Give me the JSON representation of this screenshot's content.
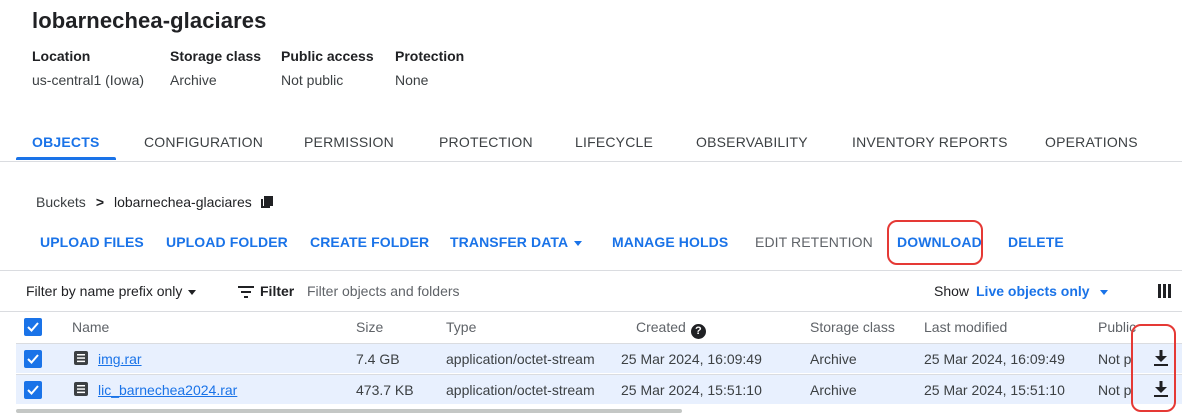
{
  "bucket": {
    "title": "lobarnechea-glaciares"
  },
  "meta": [
    {
      "label": "Location",
      "value": "us-central1 (Iowa)"
    },
    {
      "label": "Storage class",
      "value": "Archive"
    },
    {
      "label": "Public access",
      "value": "Not public"
    },
    {
      "label": "Protection",
      "value": "None"
    }
  ],
  "tabs": [
    "OBJECTS",
    "CONFIGURATION",
    "PERMISSION",
    "PROTECTION",
    "LIFECYCLE",
    "OBSERVABILITY",
    "INVENTORY REPORTS",
    "OPERATIONS"
  ],
  "active_tab": "OBJECTS",
  "breadcrumb": {
    "root": "Buckets",
    "separator": ">",
    "current": "lobarnechea-glaciares"
  },
  "actions": {
    "upload_files": "UPLOAD FILES",
    "upload_folder": "UPLOAD FOLDER",
    "create_folder": "CREATE FOLDER",
    "transfer_data": "TRANSFER DATA",
    "manage_holds": "MANAGE HOLDS",
    "edit_retention": "EDIT RETENTION",
    "download": "DOWNLOAD",
    "delete": "DELETE"
  },
  "filter": {
    "mode": "Filter by name prefix only",
    "label": "Filter",
    "placeholder": "Filter objects and folders",
    "show_label": "Show",
    "show_value": "Live objects only"
  },
  "columns": [
    "Name",
    "Size",
    "Type",
    "Created",
    "Storage class",
    "Last modified",
    "Public"
  ],
  "rows": [
    {
      "name": "img.rar",
      "size": "7.4 GB",
      "type": "application/octet-stream",
      "created": "25 Mar 2024, 16:09:49",
      "storage": "Archive",
      "modified": "25 Mar 2024, 16:09:49",
      "public": "Not p"
    },
    {
      "name": "lic_barnechea2024.rar",
      "size": "473.7 KB",
      "type": "application/octet-stream",
      "created": "25 Mar 2024, 15:51:10",
      "storage": "Archive",
      "modified": "25 Mar 2024, 15:51:10",
      "public": "Not p"
    }
  ],
  "colors": {
    "accent": "#1a73e8",
    "highlight": "#e53935",
    "row_selected": "#e8f0fe"
  }
}
